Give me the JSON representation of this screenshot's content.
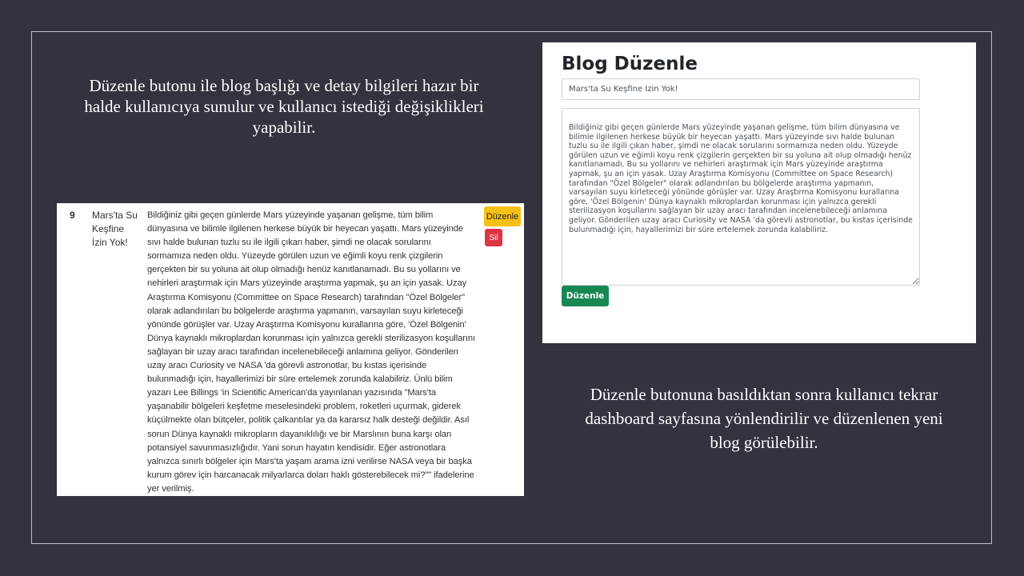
{
  "captions": {
    "top_left": "Düzenle butonu ile blog başlığı ve detay bilgileri hazır bir halde kullanıcıya sunulur ve kullanıcı istediği değişiklikleri yapabilir.",
    "bottom_right": "Düzenle butonuna basıldıktan sonra kullanıcı tekrar dashboard sayfasına yönlendirilir ve düzenlenen yeni blog görülebilir."
  },
  "table_row": {
    "id": "9",
    "title": "Mars'ta Su Keşfine İzin Yok!",
    "body": "Bildiğiniz gibi geçen günlerde Mars yüzeyinde yaşanan gelişme, tüm bilim dünyasına ve bilimle ilgilenen herkese büyük bir heyecan yaşattı. Mars yüzeyinde sıvı halde bulunan tuzlu su ile ilgili çıkan haber, şimdi ne olacak sorularını sormamıza neden oldu. Yüzeyde görülen uzun ve eğimli koyu renk çizgilerin gerçekten bir su yoluna ait olup olmadığı henüz kanıtlanamadı. Bu su yollarını ve nehirleri araştırmak için Mars yüzeyinde araştırma yapmak, şu an için yasak. Uzay Araştırma Komisyonu (Committee on Space Research) tarafından \"Özel Bölgeler\" olarak adlandırılan bu bölgelerde araştırma yapmanın, varsayılan suyu kirleteceği yönünde görüşler var. Uzay Araştırma Komisyonu kurallarına göre, 'Özel Bölgenin' Dünya kaynaklı mikroplardan korunması için yalnızca gerekli sterilizasyon koşullarını sağlayan bir uzay aracı tarafından incelenebileceği anlamına geliyor. Gönderilen uzay aracı Curiosity ve NASA 'da görevli astronotlar, bu kıstas içerisinde bulunmadığı için, hayallerimizi bir süre ertelemek zorunda kalabiliriz. Ünlü bilim yazarı Lee Billings 'in Scientific American'da yayınlanan yazısında \"Mars'ta yaşanabilir bölgeleri keşfetme meselesindeki problem, roketleri uçurmak, giderek küçülmekte olan bütçeler, politik çalkantılar ya da kararsız halk desteği değildir. Asıl sorun Dünya kaynaklı mikropların dayanıklılığı ve bir Marslının buna karşı olan potansiyel savunmasızlığıdır. Yani sorun hayatın kendisidir. Eğer astronotlara yalnızca sınırlı bölgeler için Mars'ta yaşam arama izni verilirse NASA veya bir başka kurum görev için harcanacak milyarlarca doları haklı gösterebilecek mi?\"\" ifadelerine yer verilmiş.",
    "edit_label": "Düzenle",
    "delete_label": "Sil"
  },
  "edit_form": {
    "heading": "Blog Düzenle",
    "title_value": "Mars'ta Su Keşfine İzin Yok!",
    "body_value": "Bildiğiniz gibi geçen günlerde Mars yüzeyinde yaşanan gelişme, tüm bilim dünyasına ve bilimle ilgilenen herkese büyük bir heyecan yaşattı. Mars yüzeyinde sıvı halde bulunan tuzlu su ile ilgili çıkan haber, şimdi ne olacak sorularını sormamıza neden oldu. Yüzeyde görülen uzun ve eğimli koyu renk çizgilerin gerçekten bir su yoluna ait olup olmadığı henüz kanıtlanamadı. Bu su yollarını ve nehirleri araştırmak için Mars yüzeyinde araştırma yapmak, şu an için yasak. Uzay Araştırma Komisyonu (Committee on Space Research) tarafından \"Özel Bölgeler\" olarak adlandırılan bu bölgelerde araştırma yapmanın, varsayılan suyu kirleteceği yönünde görüşler var. Uzay Araştırma Komisyonu kurallarına göre, 'Özel Bölgenin' Dünya kaynaklı mikroplardan korunması için yalnızca gerekli sterilizasyon koşullarını sağlayan bir uzay aracı tarafından incelenebileceği anlamına geliyor. Gönderilen uzay aracı Curiosity ve NASA 'da görevli astronotlar, bu kıstas içerisinde bulunmadığı için, hayallerimizi bir süre ertelemek zorunda kalabiliriz.",
    "submit_label": "Düzenle"
  },
  "colors": {
    "background": "#33333f",
    "edit_button": "#f7c016",
    "delete_button": "#dc3545",
    "submit_button": "#198754"
  }
}
